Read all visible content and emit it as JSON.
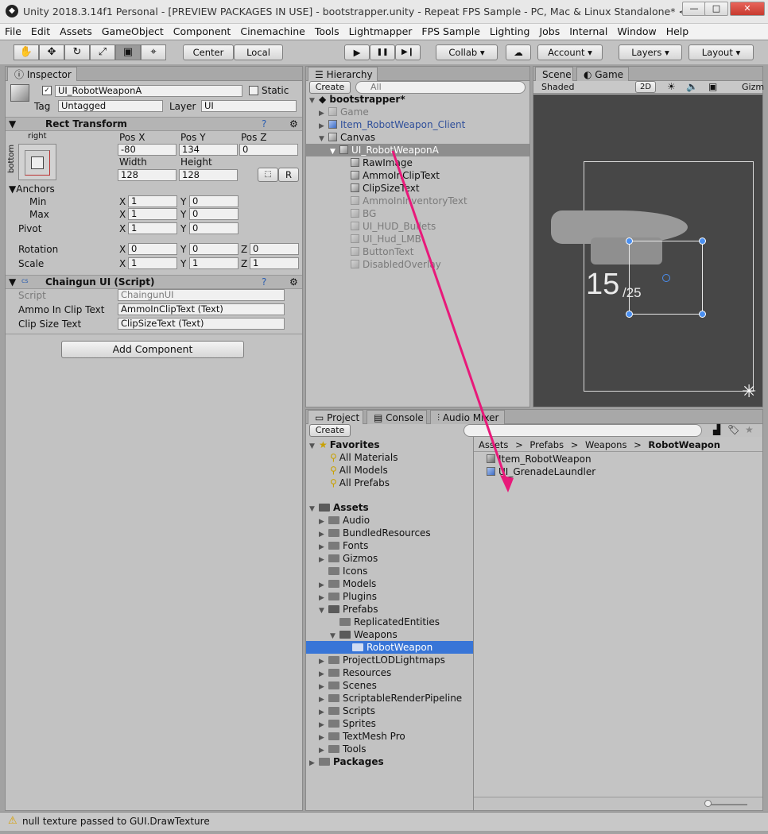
{
  "window": {
    "title": "Unity 2018.3.14f1 Personal - [PREVIEW PACKAGES IN USE] - bootstrapper.unity - Repeat FPS Sample - PC, Mac & Linux Standalone* <DX11>",
    "minimize": "—",
    "maximize": "□",
    "close": "✕",
    "logo": "◆"
  },
  "menu": [
    "File",
    "Edit",
    "Assets",
    "GameObject",
    "Component",
    "Cinemachine",
    "Tools",
    "Lightmapper",
    "FPS Sample",
    "Lighting",
    "Jobs",
    "Internal",
    "Window",
    "Help"
  ],
  "toolbar": {
    "tools": [
      "✋",
      "✥",
      "↻",
      "⤢",
      "▣",
      "⌖"
    ],
    "pivot": "Center",
    "space": "Local",
    "play": "▶",
    "pause": "❚❚",
    "step": "▶❙",
    "collab": "Collab",
    "account": "Account",
    "layers": "Layers",
    "layout": "Layout",
    "cloud": "☁",
    "dropdown": "▾"
  },
  "inspector": {
    "tab": "Inspector",
    "name": "UI_RobotWeaponA",
    "static": "Static",
    "tag_label": "Tag",
    "tag": "Untagged",
    "layer_label": "Layer",
    "layer": "UI",
    "rect": {
      "header": "Rect Transform",
      "anchor_top": "right",
      "anchor_side": "bottom",
      "posx_label": "Pos X",
      "posy_label": "Pos Y",
      "posz_label": "Pos Z",
      "posx": "-80",
      "posy": "134",
      "posz": "0",
      "width_label": "Width",
      "height_label": "Height",
      "width": "128",
      "height": "128",
      "r_button": "R",
      "blueprint_button": "⬚",
      "anchors_label": "Anchors",
      "min_label": "Min",
      "max_label": "Max",
      "pivot_label": "Pivot",
      "min_x": "1",
      "min_y": "0",
      "max_x": "1",
      "max_y": "0",
      "pivot_x": "1",
      "pivot_y": "0",
      "rotation_label": "Rotation",
      "scale_label": "Scale",
      "rot_x": "0",
      "rot_y": "0",
      "rot_z": "0",
      "scale_x": "1",
      "scale_y": "1",
      "scale_z": "1",
      "x": "X",
      "y": "Y",
      "z": "Z"
    },
    "script": {
      "header": "Chaingun UI (Script)",
      "script_label": "Script",
      "script_value": "ChaingunUI",
      "ammo_label": "Ammo In Clip Text",
      "ammo_value": "AmmoInClipText (Text)",
      "clip_label": "Clip Size Text",
      "clip_value": "ClipSizeText (Text)",
      "badge": "cs"
    },
    "add_component": "Add Component"
  },
  "hierarchy": {
    "tab": "Hierarchy",
    "create": "Create",
    "search_placeholder": "All",
    "root": "bootstrapper*",
    "items": [
      {
        "label": "Game"
      },
      {
        "label": "Item_RobotWeapon_Client"
      },
      {
        "label": "Canvas"
      },
      {
        "label": "UI_RobotWeaponA"
      },
      {
        "label": "RawImage"
      },
      {
        "label": "AmmoInClipText"
      },
      {
        "label": "ClipSizeText"
      },
      {
        "label": "AmmoInInventoryText"
      },
      {
        "label": "BG"
      },
      {
        "label": "UI_HUD_Bullets"
      },
      {
        "label": "UI_Hud_LMB"
      },
      {
        "label": "ButtonText"
      },
      {
        "label": "DisabledOverlay"
      }
    ]
  },
  "scene": {
    "tab": "Scene",
    "game_tab": "Game",
    "shading": "Shaded",
    "mode_2d": "2D",
    "gizmos": "Gizm",
    "ammo_big": "15",
    "ammo_small": "/25"
  },
  "project": {
    "tabs": [
      "Project",
      "Console",
      "Audio Mixer"
    ],
    "create": "Create",
    "favorites": "Favorites",
    "fav_items": [
      "All Materials",
      "All Models",
      "All Prefabs"
    ],
    "assets": "Assets",
    "asset_folders": [
      {
        "label": "Audio"
      },
      {
        "label": "BundledResources"
      },
      {
        "label": "Fonts"
      },
      {
        "label": "Gizmos"
      },
      {
        "label": "Icons"
      },
      {
        "label": "Models"
      },
      {
        "label": "Plugins"
      },
      {
        "label": "Prefabs"
      },
      {
        "label": "ReplicatedEntities"
      },
      {
        "label": "Weapons"
      },
      {
        "label": "RobotWeapon"
      },
      {
        "label": "ProjectLODLightmaps"
      },
      {
        "label": "Resources"
      },
      {
        "label": "Scenes"
      },
      {
        "label": "ScriptableRenderPipeline"
      },
      {
        "label": "Scripts"
      },
      {
        "label": "Sprites"
      },
      {
        "label": "TextMesh Pro"
      },
      {
        "label": "Tools"
      }
    ],
    "packages": "Packages",
    "breadcrumb": [
      "Assets",
      "Prefabs",
      "Weapons",
      "RobotWeapon"
    ],
    "sep": ">",
    "files": [
      "Item_RobotWeapon",
      "UI_GrenadeLaundler"
    ]
  },
  "status": {
    "message": "null texture passed to GUI.DrawTexture",
    "icon": "⚠"
  },
  "colors": {
    "accent": "#3875d7",
    "arrow": "#e8197a"
  }
}
